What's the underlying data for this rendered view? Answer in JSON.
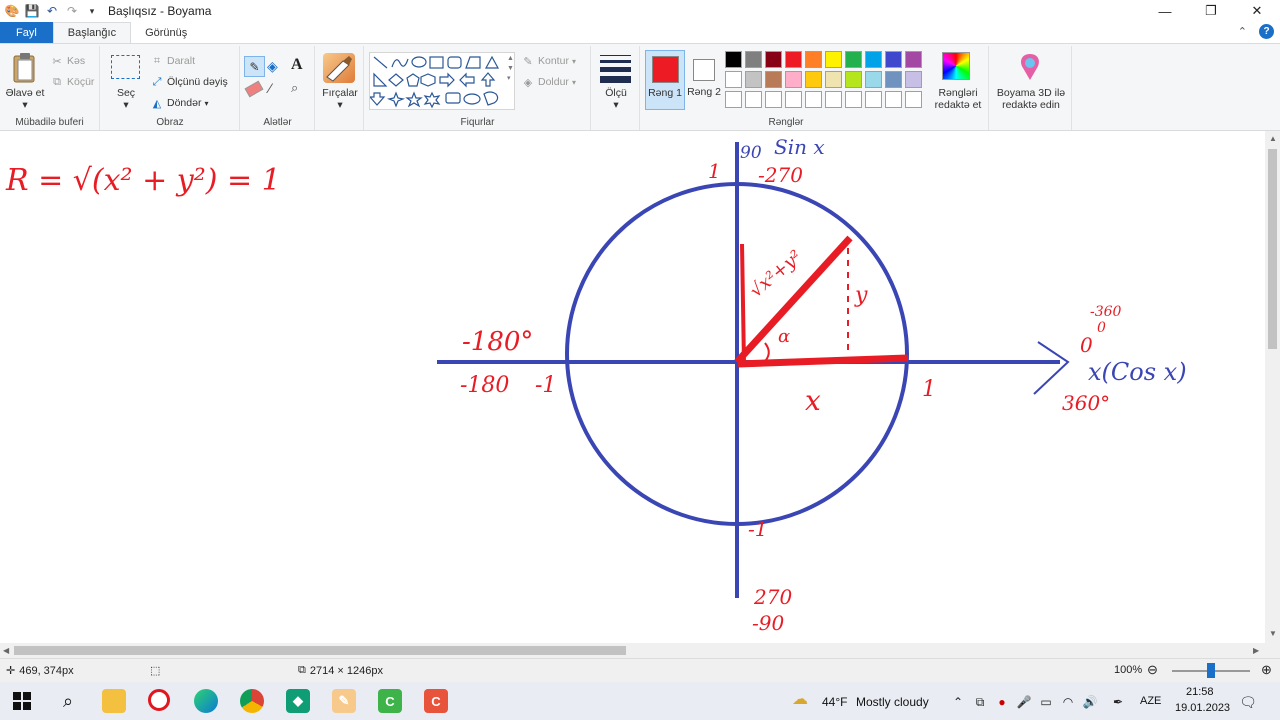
{
  "title_bar": {
    "title": "Başlıqsız - Boyama",
    "minimize": "—",
    "restore": "❐",
    "close": "✕"
  },
  "tabs": {
    "file": "Fayl",
    "home": "Başlanğıc",
    "view": "Görünüş"
  },
  "clipboard": {
    "paste": "Əlavə et",
    "cut": "Kəs",
    "copy": "Köçür",
    "label": "Mübadilə buferi"
  },
  "image": {
    "select": "Seç",
    "crop": "Daralt",
    "resize": "Ölçünü dəyiş",
    "rotate": "Döndər",
    "label": "Obraz"
  },
  "tools": {
    "label": "Alətlər"
  },
  "brushes": {
    "label": "Fırçalar"
  },
  "shapes": {
    "outline": "Kontur",
    "fill": "Doldur",
    "label": "Fiqurlar"
  },
  "size": {
    "label": "Ölçü"
  },
  "colors": {
    "color1_label": "Rəng 1",
    "color2_label": "Rəng 2",
    "label": "Rənglər",
    "edit_colors": "Rəngləri redaktə et",
    "color1": "#ed1c24",
    "color2": "#ffffff",
    "palette": [
      "#000000",
      "#7f7f7f",
      "#880015",
      "#ed1c24",
      "#ff7f27",
      "#fff200",
      "#22b14c",
      "#00a2e8",
      "#3f48cc",
      "#a349a4",
      "#ffffff",
      "#c3c3c3",
      "#b97a57",
      "#ffaec9",
      "#ffc90e",
      "#efe4b0",
      "#b5e61d",
      "#99d9ea",
      "#7092be",
      "#c8bfe7",
      "#ffffff",
      "#ffffff",
      "#ffffff",
      "#ffffff",
      "#ffffff",
      "#ffffff",
      "#ffffff",
      "#ffffff",
      "#ffffff",
      "#ffffff"
    ]
  },
  "paint3d": {
    "label": "Boyama 3D ilə redaktə edin"
  },
  "drawing": {
    "formula": "R = √(x² + y²) = 1",
    "label_90": "90",
    "label_sin": "Sin x",
    "label_top_1": "1",
    "label_neg270": "-270",
    "label_neg180deg": "-180°",
    "label_neg180": "-180",
    "label_neg1_left": "-1",
    "label_1_right": "1",
    "label_x": "x",
    "label_y": "y",
    "label_sqrt": "√x²+y²",
    "label_alpha": "α",
    "label_cos": "x(Cos x)",
    "label_neg360": "-360",
    "label_0deg": "0",
    "label_0": "0",
    "label_360": "360°",
    "label_neg1_bottom": "-1",
    "label_270": "270",
    "label_neg90": "-90"
  },
  "status": {
    "cursor": "469, 374px",
    "size": "2714 × 1246px",
    "zoom": "100%"
  },
  "taskbar": {
    "weather_temp": "44°F",
    "weather_text": "Mostly cloudy",
    "language": "AZE",
    "time": "21:58",
    "date": "19.01.2023"
  }
}
